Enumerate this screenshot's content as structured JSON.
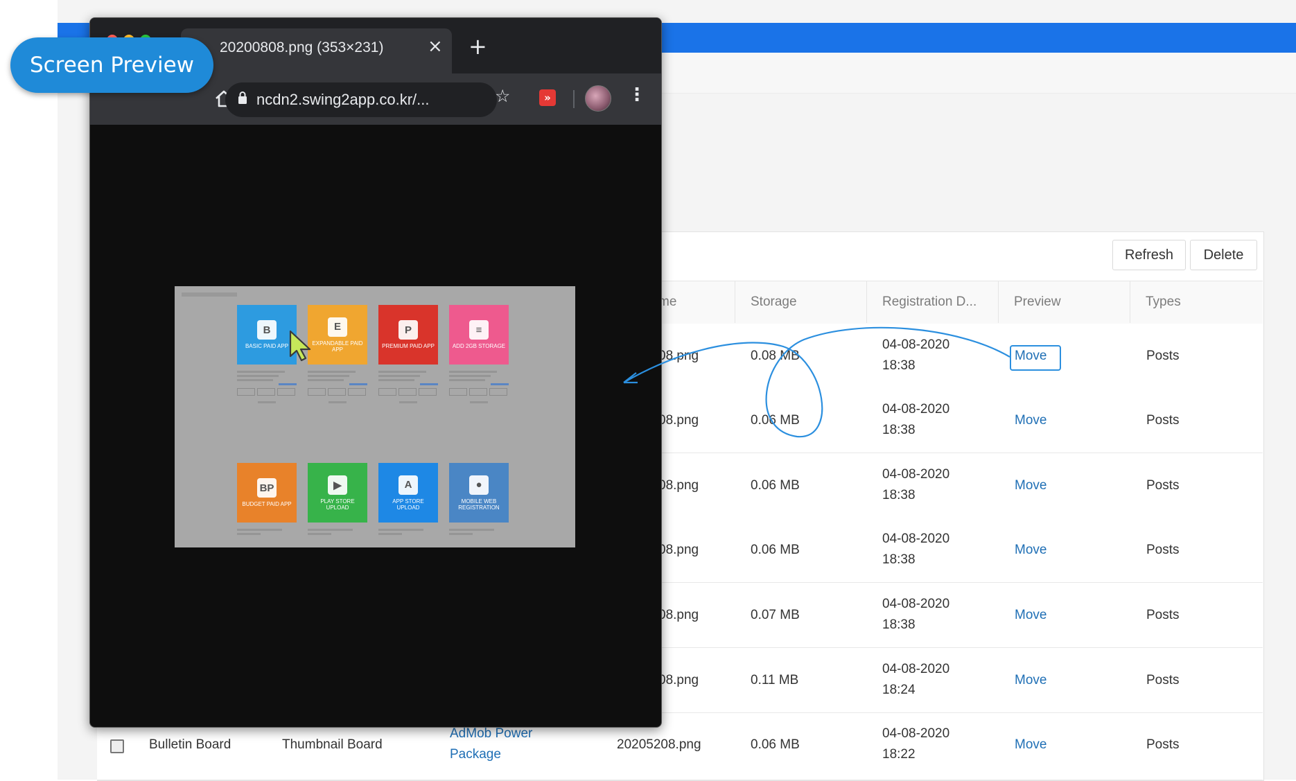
{
  "badge": {
    "label": "Screen Preview"
  },
  "browser": {
    "tab_title": "20200808.png (353×231)",
    "tab_close": "×",
    "new_tab": "+",
    "url": "ncdn2.swing2app.co.kr/..."
  },
  "preview_image": {
    "cards": [
      {
        "letter": "B",
        "name": "BASIC PAID APP",
        "color": "#2d9be0"
      },
      {
        "letter": "E",
        "name": "EXPANDABLE PAID APP",
        "color": "#f0a630"
      },
      {
        "letter": "P",
        "name": "PREMIUM PAID APP",
        "color": "#d9342b"
      },
      {
        "letter": "≡",
        "name": "ADD 2GB STORAGE",
        "color": "#ee5a8e"
      },
      {
        "letter": "BP",
        "name": "BUDGET PAID APP",
        "color": "#e8822a"
      },
      {
        "letter": "▶",
        "name": "PLAY STORE UPLOAD",
        "color": "#37b34a"
      },
      {
        "letter": "A",
        "name": "APP STORE UPLOAD",
        "color": "#1e88e5"
      },
      {
        "letter": "●",
        "name": "MOBILE WEB REGISTRATION",
        "color": "#4a86c5"
      }
    ]
  },
  "toolbar": {
    "refresh": "Refresh",
    "delete": "Delete"
  },
  "table": {
    "headers": {
      "name": "me",
      "storage": "Storage",
      "date": "Registration D...",
      "preview": "Preview",
      "types": "Types"
    },
    "rows": [
      {
        "filename": "08.png",
        "storage": "0.08 MB",
        "date": "04-08-2020",
        "time": "18:38",
        "preview": "Move",
        "type": "Posts"
      },
      {
        "filename": "08.png",
        "storage": "0.06 MB",
        "date": "04-08-2020",
        "time": "18:38",
        "preview": "Move",
        "type": "Posts"
      },
      {
        "filename": "08.png",
        "storage": "0.06 MB",
        "date": "04-08-2020",
        "time": "18:38",
        "preview": "Move",
        "type": "Posts"
      },
      {
        "filename": "08.png",
        "storage": "0.06 MB",
        "date": "04-08-2020",
        "time": "18:38",
        "preview": "Move",
        "type": "Posts"
      },
      {
        "filename": "08.png",
        "storage": "0.07 MB",
        "date": "04-08-2020",
        "time": "18:38",
        "preview": "Move",
        "type": "Posts"
      },
      {
        "filename": "08.png",
        "storage": "0.11 MB",
        "date": "04-08-2020",
        "time": "18:24",
        "preview": "Move",
        "type": "Posts"
      }
    ],
    "last_row": {
      "board": "Bulletin Board",
      "board_type": "Thumbnail Board",
      "title_line1": "AdMob Power",
      "title_line2": "Package",
      "filename": "20205208.png",
      "storage": "0.06 MB",
      "date": "04-08-2020",
      "time": "18:22",
      "preview": "Move",
      "type": "Posts"
    }
  },
  "colors": {
    "accent_blue": "#1a73e8",
    "link_blue": "#1f6fb5",
    "badge_blue": "#1f8ad8",
    "annotation_blue": "#2b8fdf"
  }
}
